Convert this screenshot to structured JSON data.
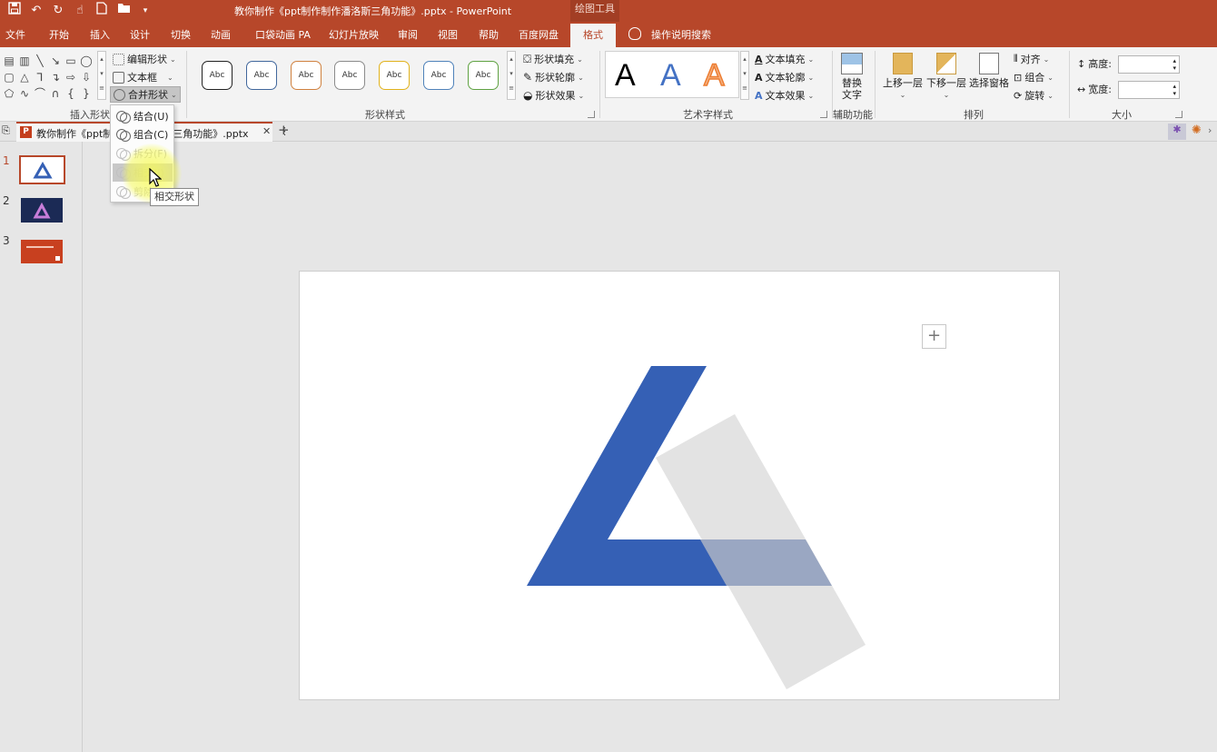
{
  "app": {
    "document_title": "教你制作《ppt制作制作潘洛斯三角功能》.pptx  -  PowerPoint",
    "context_tab": "绘图工具"
  },
  "qat": {
    "icons": [
      "save-icon",
      "undo-icon",
      "redo-icon",
      "touch-mode-icon",
      "new-file-icon",
      "open-file-icon",
      "customize-qat-icon"
    ]
  },
  "ribbon_tabs": [
    "文件",
    "开始",
    "插入",
    "设计",
    "切换",
    "动画",
    "口袋动画 PA",
    "幻灯片放映",
    "审阅",
    "视图",
    "帮助",
    "百度网盘",
    "格式"
  ],
  "active_tab": "格式",
  "tell_me": "操作说明搜索",
  "groups": {
    "insert_shapes": {
      "label": "插入形状",
      "edit_shape": "编辑形状",
      "text_box": "文本框",
      "merge_shapes": "合并形状"
    },
    "shape_styles": {
      "label": "形状样式",
      "sample_text": "Abc",
      "swatches": [
        "#222222",
        "#41679c",
        "#d0813f",
        "#8b8b8b",
        "#e1b21c",
        "#4f82ba",
        "#5fa242"
      ],
      "fill": "形状填充",
      "outline": "形状轮廓",
      "effects": "形状效果"
    },
    "wordart": {
      "label": "艺术字样式",
      "letter": "A",
      "colors": [
        "#000000",
        "#4472c4",
        "#ed7d31"
      ],
      "fill": "文本填充",
      "outline": "文本轮廓",
      "effects": "文本效果"
    },
    "accessibility": {
      "label": "辅助功能",
      "alt_text_1": "替换",
      "alt_text_2": "文字"
    },
    "arrange": {
      "label": "排列",
      "bring_forward": "上移一层",
      "send_backward": "下移一层",
      "selection_pane": "选择窗格",
      "align": "对齐",
      "group": "组合",
      "rotate": "旋转"
    },
    "size": {
      "label": "大小",
      "height": "高度:",
      "width": "宽度:"
    }
  },
  "merge_menu": {
    "items": [
      {
        "label": "结合(U)",
        "disabled": false
      },
      {
        "label": "组合(C)",
        "disabled": false
      },
      {
        "label": "拆分(F)",
        "disabled": true
      },
      {
        "label": "相交(I)",
        "disabled": true,
        "hover": true
      },
      {
        "label": "剪除(S)",
        "disabled": true
      }
    ],
    "tooltip": "相交形状"
  },
  "doc_tab": {
    "label": "教你制作《ppt制作制作潘洛斯三角功能》.pptx",
    "badge": "P",
    "new_tab": "+"
  },
  "slides": [
    "1",
    "2",
    "3"
  ],
  "canvas": {
    "add_button": "+",
    "colors": {
      "blue": "#3560b5",
      "gray": "#e0e0e0",
      "overlap": "#9aa7c2"
    }
  }
}
